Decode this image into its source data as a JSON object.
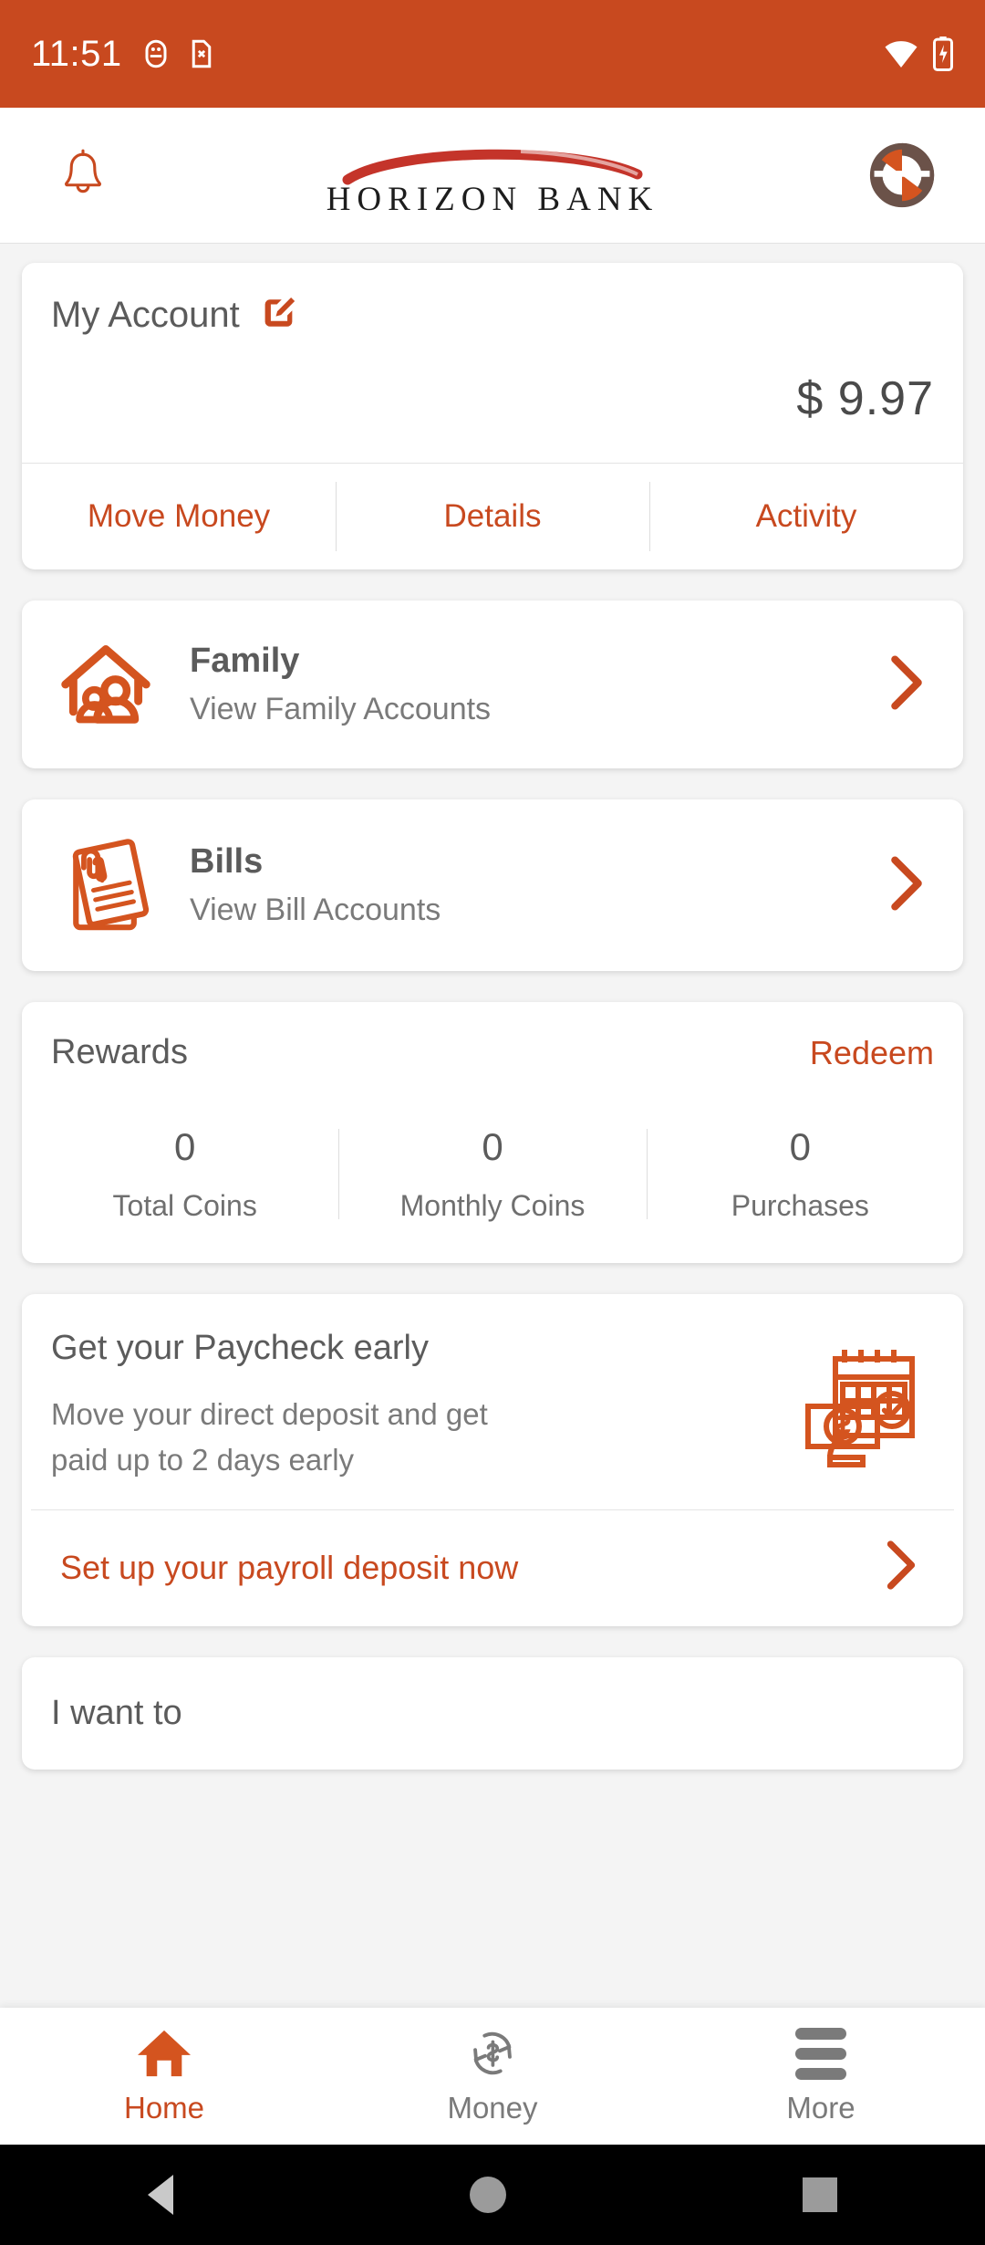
{
  "status_bar": {
    "time": "11:51",
    "icons": [
      "usb-debug-icon",
      "sim-error-icon",
      "wifi-icon",
      "battery-charging-icon"
    ]
  },
  "header": {
    "notifications_icon": "bell-icon",
    "brand_name": "HORIZON BANK",
    "logo_icon": "horizon-ring-logo",
    "profile_icon": "profile-logo-avatar"
  },
  "account_card": {
    "title": "My Account",
    "edit_icon": "edit-pencil-icon",
    "balance": "$ 9.97",
    "actions": [
      {
        "label": "Move Money"
      },
      {
        "label": "Details"
      },
      {
        "label": "Activity"
      }
    ]
  },
  "family_card": {
    "icon": "house-family-icon",
    "title": "Family",
    "subtitle": "View Family Accounts",
    "chevron": "chevron-right-icon"
  },
  "bills_card": {
    "icon": "bill-document-icon",
    "title": "Bills",
    "subtitle": "View Bill Accounts",
    "chevron": "chevron-right-icon"
  },
  "rewards_card": {
    "title": "Rewards",
    "redeem_label": "Redeem",
    "stats": [
      {
        "value": "0",
        "label": "Total Coins"
      },
      {
        "value": "0",
        "label": "Monthly Coins"
      },
      {
        "value": "0",
        "label": "Purchases"
      }
    ]
  },
  "paycheck_card": {
    "title": "Get your Paycheck early",
    "description": "Move your direct deposit and get paid up to 2 days early",
    "icon": "payday-calendar-icon",
    "cta_label": "Set up your payroll deposit now",
    "chevron": "chevron-right-icon"
  },
  "i_want_to": {
    "title": "I want to"
  },
  "bottom_nav": {
    "items": [
      {
        "label": "Home",
        "icon": "home-icon",
        "active": true
      },
      {
        "label": "Money",
        "icon": "money-transfer-icon",
        "active": false
      },
      {
        "label": "More",
        "icon": "hamburger-menu-icon",
        "active": false
      }
    ]
  },
  "system_nav": {
    "back": "back-triangle-icon",
    "home": "home-circle-icon",
    "recents": "recents-square-icon"
  },
  "colors": {
    "brand_orange": "#c8491f",
    "status_bar": "#c8491f",
    "text_primary": "#5b5b5b",
    "text_secondary": "#7a7a7a",
    "page_bg": "#f4f4f4"
  }
}
